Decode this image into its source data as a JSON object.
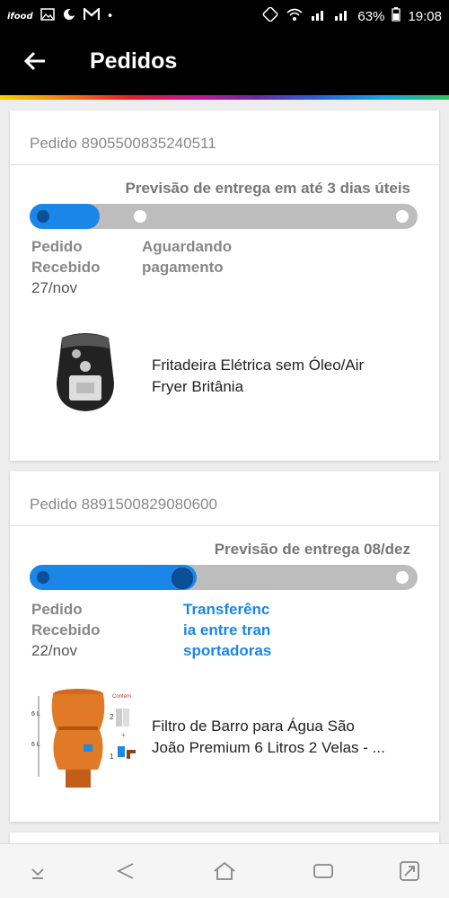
{
  "status_bar": {
    "battery": "63%",
    "time": "19:08",
    "left_icons": [
      "ifood-icon",
      "image-icon",
      "weather-icon",
      "gmail-icon",
      "dot-icon"
    ],
    "right_icons": [
      "nfc-icon",
      "wifi-icon",
      "signal-1-icon",
      "signal-2-icon",
      "battery-icon"
    ]
  },
  "appbar": {
    "title": "Pedidos"
  },
  "orders": [
    {
      "order_label": "Pedido 8905500835240511",
      "forecast": "Previsão de entrega em até 3 dias úteis",
      "progress": 0.18,
      "steps": [
        {
          "label1": "Pedido",
          "label2": "Recebido",
          "date": "27/nov"
        },
        {
          "label1": "Aguardando",
          "label2": "pagamento"
        }
      ],
      "product": {
        "name_line1": "Fritadeira Elétrica sem Óleo/Air",
        "name_line2": "Fryer Britânia"
      }
    },
    {
      "order_label": "Pedido 8891500829080600",
      "forecast": "Previsão de entrega 08/dez",
      "progress": 0.43,
      "steps": [
        {
          "label1": "Pedido",
          "label2": "Recebido",
          "date": "22/nov"
        },
        {
          "label1": "Transferênc",
          "label2": "ia entre tran",
          "label3": "sportadoras"
        }
      ],
      "product": {
        "name_line1": "Filtro de Barro para Água São",
        "name_line2": "João Premium 6 Litros 2 Velas - ..."
      },
      "image_text": {
        "contains": "Contém",
        "l1": "6 L",
        "l2": "6 L",
        "q1": "2",
        "q2": "1"
      }
    }
  ],
  "colors": {
    "accent": "#1a86e8",
    "dark_dot": "#0b4f96",
    "track": "#bdbdbd"
  }
}
